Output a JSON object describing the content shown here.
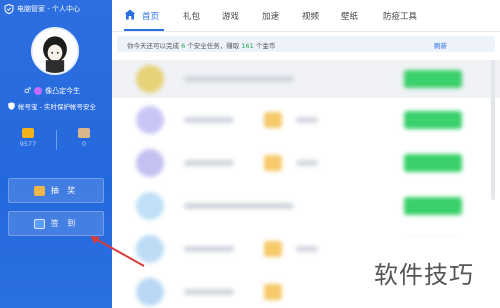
{
  "window": {
    "title": "电脑管家 - 个人中心"
  },
  "profile": {
    "username": "像凸定今生",
    "security_status": "帐号宝 - 实时保护帐号安全"
  },
  "stats": [
    {
      "icon": "coin-icon",
      "value": "9577"
    },
    {
      "icon": "gift-box-icon",
      "value": "0"
    }
  ],
  "actions": {
    "lottery_label": "抽 奖",
    "checkin_label": "签 到"
  },
  "nav": {
    "tabs": [
      {
        "label": "首页",
        "active": true
      },
      {
        "label": "礼包",
        "active": false
      },
      {
        "label": "游戏",
        "active": false
      },
      {
        "label": "加速",
        "active": false
      },
      {
        "label": "视频",
        "active": false
      },
      {
        "label": "壁纸",
        "active": false
      },
      {
        "label": "防疫工具",
        "active": false
      }
    ]
  },
  "tasks_banner": {
    "prefix": "你今天还可以完成",
    "task_count": "6",
    "middle": "个安全任务，赚取",
    "coin_count": "161",
    "suffix": "个金币",
    "refresh_label": "刷新"
  },
  "watermark": {
    "text": "软件技巧"
  },
  "colors": {
    "sidebar_blue": "#2468dd",
    "accent_blue": "#2a6fe0",
    "success_green": "#3ad06b",
    "coin_gold": "#f3b11e",
    "arrow_red": "#d93a3a"
  }
}
